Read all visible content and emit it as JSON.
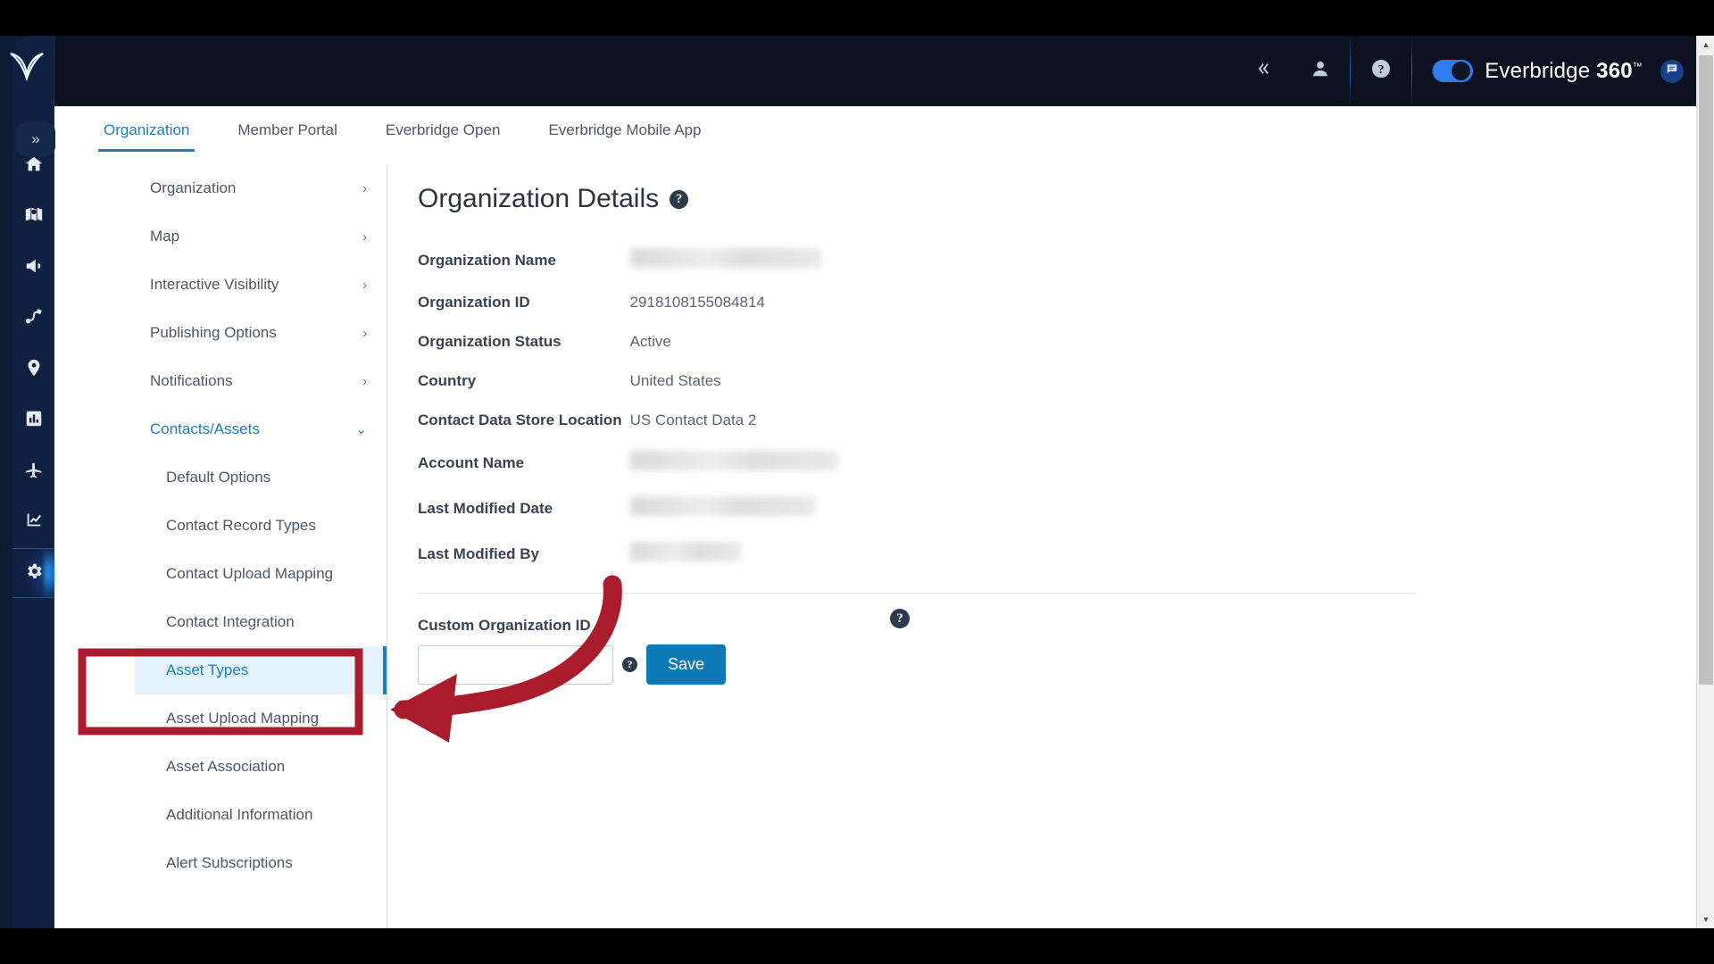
{
  "header": {
    "collapse_icon": "chevron-double-left-icon",
    "user_icon": "user-icon",
    "help_icon": "help-circle-icon",
    "brand_name": "Everbridge 360",
    "brand_tm": "™",
    "feedback_icon": "feedback-icon",
    "toggle_on": true
  },
  "rail": {
    "logo_name": "everbridge-logo",
    "expand_label": "»",
    "items": [
      {
        "name": "home-icon",
        "active": false
      },
      {
        "name": "map-pin-icon",
        "active": false
      },
      {
        "name": "megaphone-icon",
        "active": false
      },
      {
        "name": "incident-flow-icon",
        "active": false
      },
      {
        "name": "location-pin-icon",
        "active": false
      },
      {
        "name": "chart-bar-icon",
        "active": false
      },
      {
        "name": "travel-plane-icon",
        "active": false
      },
      {
        "name": "analytics-line-icon",
        "active": false
      },
      {
        "name": "settings-gear-icon",
        "active": true
      }
    ]
  },
  "tabs": [
    {
      "label": "Organization",
      "active": true
    },
    {
      "label": "Member Portal",
      "active": false
    },
    {
      "label": "Everbridge Open",
      "active": false
    },
    {
      "label": "Everbridge Mobile App",
      "active": false
    }
  ],
  "nav": {
    "groups": [
      {
        "label": "Organization",
        "expanded": false,
        "chevron": "›"
      },
      {
        "label": "Map",
        "expanded": false,
        "chevron": "›"
      },
      {
        "label": "Interactive Visibility",
        "expanded": false,
        "chevron": "›"
      },
      {
        "label": "Publishing Options",
        "expanded": false,
        "chevron": "›"
      },
      {
        "label": "Notifications",
        "expanded": false,
        "chevron": "›"
      },
      {
        "label": "Contacts/Assets",
        "expanded": true,
        "chevron": "⌄"
      }
    ],
    "sub_items": [
      {
        "label": "Default Options",
        "selected": false
      },
      {
        "label": "Contact Record Types",
        "selected": false
      },
      {
        "label": "Contact Upload Mapping",
        "selected": false
      },
      {
        "label": "Contact Integration",
        "selected": false
      },
      {
        "label": "Asset Types",
        "selected": true
      },
      {
        "label": "Asset Upload Mapping",
        "selected": false
      },
      {
        "label": "Asset Association",
        "selected": false
      },
      {
        "label": "Additional Information",
        "selected": false
      },
      {
        "label": "Alert Subscriptions",
        "selected": false
      }
    ]
  },
  "detail": {
    "title": "Organization Details",
    "title_help_icon": "help-circle-icon",
    "fields": [
      {
        "key": "Organization Name",
        "value": "",
        "redacted": true,
        "redact_width": 214
      },
      {
        "key": "Organization ID",
        "value": "2918108155084814",
        "redacted": false
      },
      {
        "key": "Organization Status",
        "value": "Active",
        "redacted": false
      },
      {
        "key": "Country",
        "value": "United States",
        "redacted": false
      },
      {
        "key": "Contact Data Store Location",
        "value": "US Contact Data 2",
        "redacted": false
      },
      {
        "key": "Account Name",
        "value": "",
        "redacted": true,
        "redact_width": 233
      },
      {
        "key": "Last Modified Date",
        "value": "",
        "redacted": true,
        "redact_width": 207
      },
      {
        "key": "Last Modified By",
        "value": "",
        "redacted": true,
        "redact_width": 124
      }
    ],
    "custom_org_id_label": "Custom Organization ID",
    "custom_org_id_value": "",
    "custom_org_id_placeholder": "",
    "custom_help_icon": "help-circle-icon",
    "save_label": "Save",
    "floating_help_icon": "help-circle-icon"
  },
  "annotations": {
    "highlight_box": "asset-types-highlight",
    "arrow": "curved-red-arrow-pointing-left",
    "color": "#aa1b2b"
  },
  "scrollbar": {
    "up_arrow": "▲",
    "down_arrow": "▼"
  },
  "colors": {
    "accent_blue": "#1a7ec9",
    "save_blue": "#0d7ab8",
    "rail_dark": "#0f2041",
    "header_dark": "#0c1220",
    "annotation_red": "#aa1b2b",
    "selected_bg": "#e4f2fb"
  }
}
